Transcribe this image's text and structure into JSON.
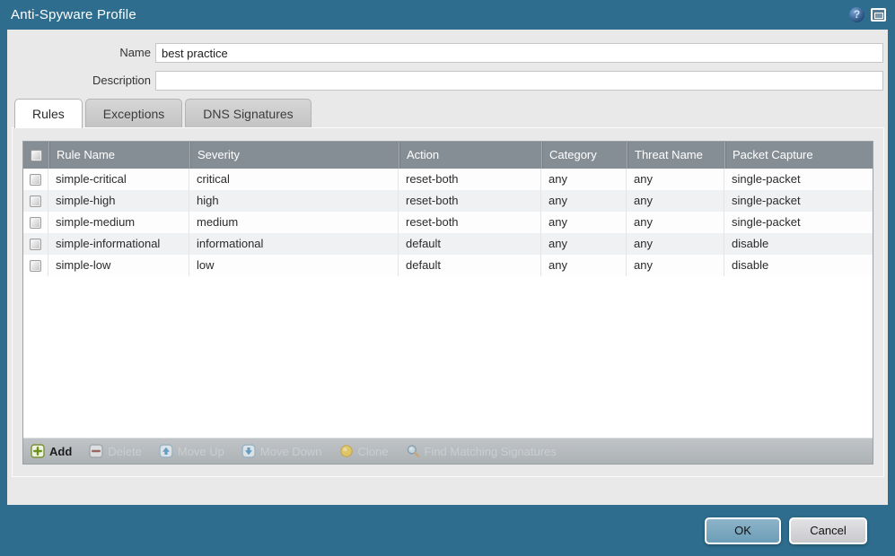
{
  "dialog": {
    "title": "Anti-Spyware Profile",
    "title_icons": {
      "help": "help-icon",
      "window": "window-icon"
    },
    "fields": {
      "name_label": "Name",
      "name_value": "best practice",
      "description_label": "Description",
      "description_value": ""
    },
    "tabs": [
      {
        "label": "Rules",
        "active": true
      },
      {
        "label": "Exceptions",
        "active": false
      },
      {
        "label": "DNS Signatures",
        "active": false
      }
    ],
    "table": {
      "columns": [
        "Rule Name",
        "Severity",
        "Action",
        "Category",
        "Threat Name",
        "Packet Capture"
      ],
      "rows": [
        {
          "rule_name": "simple-critical",
          "severity": "critical",
          "action": "reset-both",
          "category": "any",
          "threat_name": "any",
          "packet_capture": "single-packet"
        },
        {
          "rule_name": "simple-high",
          "severity": "high",
          "action": "reset-both",
          "category": "any",
          "threat_name": "any",
          "packet_capture": "single-packet"
        },
        {
          "rule_name": "simple-medium",
          "severity": "medium",
          "action": "reset-both",
          "category": "any",
          "threat_name": "any",
          "packet_capture": "single-packet"
        },
        {
          "rule_name": "simple-informational",
          "severity": "informational",
          "action": "default",
          "category": "any",
          "threat_name": "any",
          "packet_capture": "disable"
        },
        {
          "rule_name": "simple-low",
          "severity": "low",
          "action": "default",
          "category": "any",
          "threat_name": "any",
          "packet_capture": "disable"
        }
      ]
    },
    "toolbar": [
      {
        "label": "Add",
        "icon": "add-icon",
        "enabled": true
      },
      {
        "label": "Delete",
        "icon": "delete-icon",
        "enabled": false
      },
      {
        "label": "Move Up",
        "icon": "move-up-icon",
        "enabled": false
      },
      {
        "label": "Move Down",
        "icon": "move-down-icon",
        "enabled": false
      },
      {
        "label": "Clone",
        "icon": "clone-icon",
        "enabled": false
      },
      {
        "label": "Find Matching Signatures",
        "icon": "find-matching-signatures-icon",
        "enabled": false
      }
    ],
    "footer": {
      "ok_label": "OK",
      "cancel_label": "Cancel"
    },
    "colors": {
      "frame_teal": "#2e6d8e",
      "body_bg": "#e9e9e9",
      "grid_header_bg": "#868e95",
      "ok_button_blue": "#6c9db7",
      "row_alt_bg": "#eff1f3"
    }
  }
}
